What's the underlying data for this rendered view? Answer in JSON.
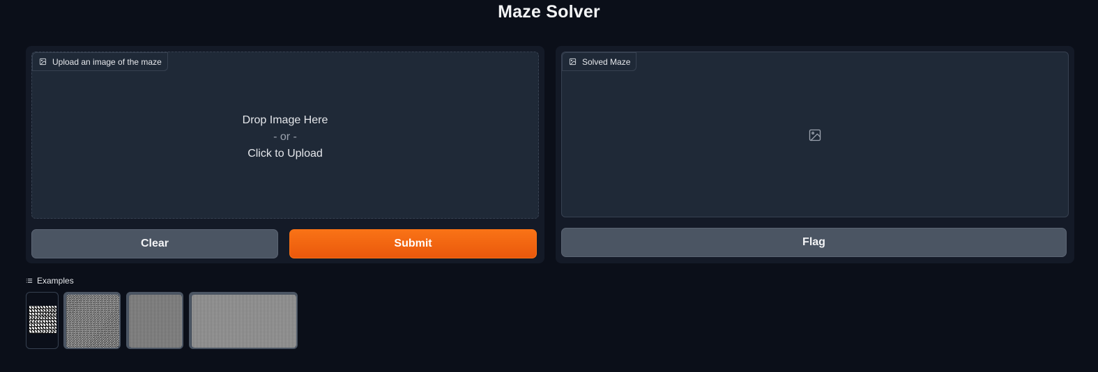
{
  "app": {
    "title": "Maze Solver"
  },
  "input": {
    "label": "Upload an image of the maze",
    "label_icon": "image-icon",
    "drop_text": "Drop Image Here",
    "or_text": "- or -",
    "upload_text": "Click to Upload"
  },
  "output": {
    "label": "Solved Maze",
    "label_icon": "image-icon",
    "placeholder_icon": "image-icon"
  },
  "buttons": {
    "clear_label": "Clear",
    "submit_label": "Submit",
    "flag_label": "Flag"
  },
  "examples": {
    "label": "Examples",
    "label_icon": "list-icon",
    "items": [
      {
        "name": "example-1"
      },
      {
        "name": "example-2"
      },
      {
        "name": "example-3"
      },
      {
        "name": "example-4"
      }
    ]
  },
  "colors": {
    "background": "#0b0f19",
    "panel": "#141a27",
    "block": "#1f2937",
    "primary": "#f97316",
    "secondary": "#4b5563"
  }
}
